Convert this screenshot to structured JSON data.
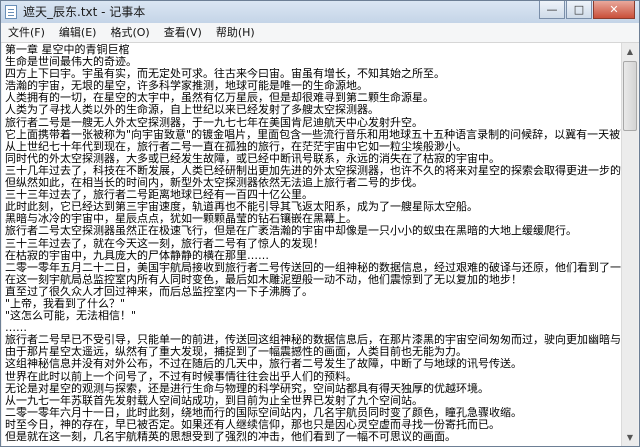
{
  "window": {
    "title": "遮天_辰东.txt - 记事本",
    "controls": {
      "minimize": "—",
      "maximize": "□",
      "close": "✕"
    }
  },
  "menu": [
    "文件(F)",
    "编辑(E)",
    "格式(O)",
    "查看(V)",
    "帮助(H)"
  ],
  "icons": {
    "app": "notepad-icon",
    "scroll_up": "▲",
    "scroll_down": "▼"
  },
  "content": {
    "lines": [
      "第一章 星空中的青铜巨棺",
      "生命是世间最伟大的奇迹。",
      "四方上下曰宇。宇虽有实，而无定处可求。往古来今曰宙。宙虽有增长，不知其始之所至。",
      "浩瀚的宇宙，无垠的星空，许多科学家推测，地球可能是唯一的生命源地。",
      "人类拥有的一切，在星空的太宇中，虽然有亿万星辰，但是却很难寻到第二颗生命源星。",
      "人类为了寻找人类以外的生命源，自上世纪以来已经发射了多艘太空探测器。",
      "旅行者二号是一艘无人外太空探测器，于一九七七年在美国肯尼迪航天中心发射升空。",
      "它上面携带着一张被称为\"向宇宙致意\"的镀金唱片，里面包含一些流行音乐和用地球五十五种语言录制的问候辞，以冀有一天被可能存在的外星文明拦截和收到。",
      "从上世纪七十年代到现在，旅行者二号一直在孤独的旅行，在茫茫宇宙中它如一粒尘埃般渺小。",
      "同时代的外太空探测器，大多或已经发生故障，或已经中断讯号联系，永远的消失在了枯寂的宇宙中。",
      "三十几年过去了，科技在不断发展，人类已经研制出更加先进的外太空探测器，也许不久的将来对星空的探索会取得更进一步的发展。",
      "但纵然如此，在相当长的时间内，新型外太空探测器依然无法追上旅行者二号的步伐。",
      "三十三年过去了，旅行者二号距离地球已经有一百四十亿公里。",
      "此时此刻，它已经达到第三宇宙速度，轨道再也不能引导其飞返太阳系，成为了一艘星际太空船。",
      "黑暗与冰冷的宇宙中，星辰点点，犹如一颗颗晶莹的钻石镶嵌在黑幕上。",
      "旅行者二号太空探测器虽然正在极速飞行，但是在广袤浩瀚的宇宙中却像是一只小小的蚁虫在黑暗的大地上缓缓爬行。",
      "三十三年过去了，就在今天这一刻，旅行者二号有了惊人的发现！",
      "在枯寂的宇宙中，九具庞大的尸体静静的横在那里……",
      "二零一零年五月二十二日，美国宇航局接收到旅行者二号传送回的一组神秘的数据信息，经过艰难的破译与还原，他们看到了一幅不可思议的画面。",
      "在这一刻宇航局总监控室内所有人同时变色，最后如木雕泥塑般一动不动，他们震惊到了无以复加的地步！",
      "直至过了很久众人才回过神来，而后总监控室内一下子沸腾了。",
      "\"上帝，我看到了什么？\"",
      "\"这怎么可能，无法相信！\"",
      "……",
      "旅行者二号早已不受引导，只能单一的前进，传送回这组神秘的数据信息后，在那片漆黑的宇宙空间匆匆而过，驶向更加幽暗与深远的星空。",
      "由于那片星空太遥远，纵然有了重大发现，捕捉到了一幅震撼性的画面，人类目前也无能为力。",
      "这组神秘信息并没有对外公布，不过在随后的几天中，旅行者二号发生了故障，中断了与地球的讯号传送。",
      "世界在此时以前上一个问号了，不过有时候事情往往会出乎人们的预料。",
      "无论是对星空的观测与探索，还是进行生命与物理的科学研究，空间站都具有得天独厚的优越环境。",
      "从一九七一年苏联首先发射载人空间站成功，到目前为止全世界已发射了九个空间站。",
      "二零一零年六月十一日，此时此刻，绕地而行的国际空间站内，几名宇航员同时变了颜色，瞳孔急骤收缩。",
      "时至今日，神的存在，早已被否定。如果还有人继续信仰，那也只是因心灵空虚而寻找一份寄托而已。",
      "但是就在这一刻，几名宇航精英的思想受到了强烈的冲击，他们看到了一幅不可思议的画面。"
    ]
  }
}
